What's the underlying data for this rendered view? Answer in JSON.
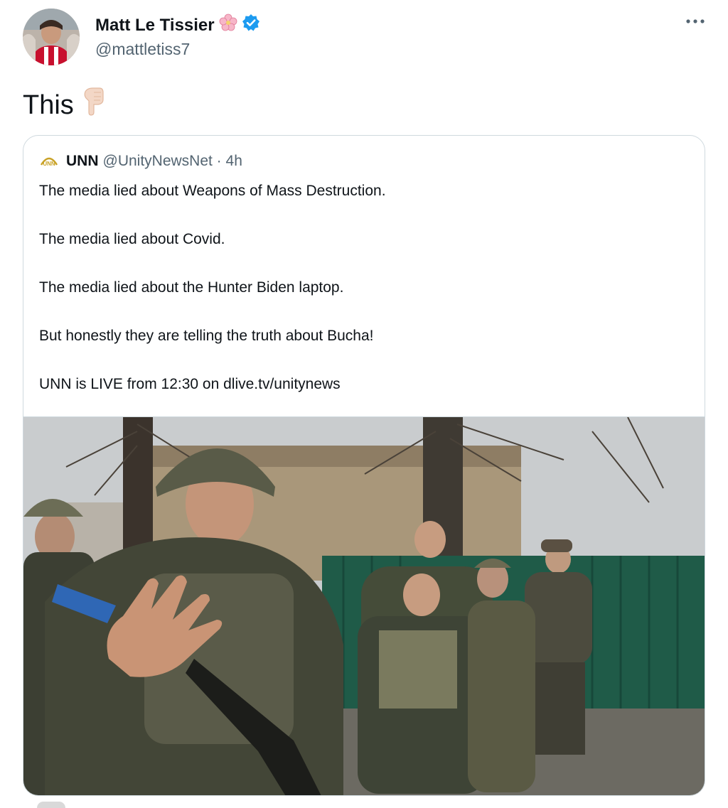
{
  "tweet": {
    "display_name": "Matt Le Tissier",
    "handle": "@mattletiss7",
    "text": "This",
    "name_emoji_icon": "cherry-blossom-icon",
    "verified_icon": "verified-badge-icon",
    "text_emoji_icon": "pointing-down-icon",
    "more_icon": "more-options-icon"
  },
  "quoted_tweet": {
    "logo_text": "UNN",
    "name": "UNN",
    "meta": "@UnityNewsNet · 4h",
    "lines": [
      "The media lied about Weapons of Mass Destruction.",
      "The media lied about Covid.",
      "The media lied about the Hunter Biden laptop.",
      "But honestly they are telling the truth about Bucha!",
      "UNN is LIVE from 12:30 on dlive.tv/unitynews"
    ]
  },
  "colors": {
    "text": "#0f1419",
    "secondary": "#536471",
    "border": "#cfd9de",
    "verified": "#1d9bf0"
  }
}
